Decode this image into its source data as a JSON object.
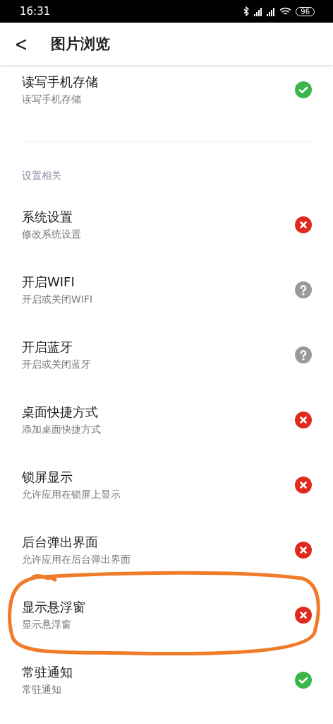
{
  "status_bar": {
    "time": "16:31",
    "battery": "96"
  },
  "header": {
    "back": "<",
    "title": "图片浏览"
  },
  "sections": [
    {
      "items": [
        {
          "title": "读写手机存储",
          "subtitle": "读写手机存储",
          "kind": "granted"
        }
      ]
    },
    {
      "label": "设置相关",
      "items": [
        {
          "title": "系统设置",
          "subtitle": "修改系统设置",
          "kind": "denied"
        },
        {
          "title": "开启WIFI",
          "subtitle": "开启或关闭WIFI",
          "kind": "unknown"
        },
        {
          "title": "开启蓝牙",
          "subtitle": "开启或关闭蓝牙",
          "kind": "unknown"
        },
        {
          "title": "桌面快捷方式",
          "subtitle": "添加桌面快捷方式",
          "kind": "denied"
        },
        {
          "title": "锁屏显示",
          "subtitle": "允许应用在锁屏上显示",
          "kind": "denied"
        },
        {
          "title": "后台弹出界面",
          "subtitle": "允许应用在后台弹出界面",
          "kind": "denied"
        },
        {
          "title": "显示悬浮窗",
          "subtitle": "显示悬浮窗",
          "kind": "denied",
          "circled": true
        },
        {
          "title": "常驻通知",
          "subtitle": "常驻通知",
          "kind": "granted"
        }
      ]
    }
  ]
}
